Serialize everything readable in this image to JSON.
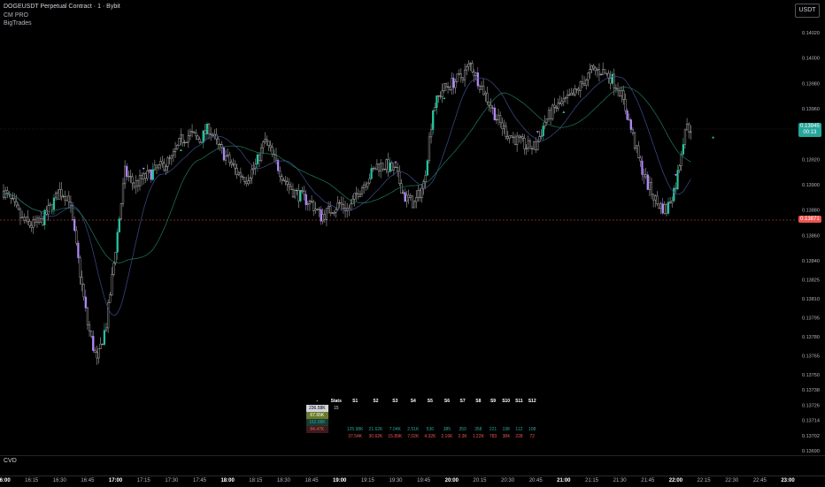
{
  "header": {
    "symbol_title": "DOGEUSDT Perpetual Contract · 1 · Bybit",
    "indicator_1": "CM PRO",
    "indicator_2": "BigTrades",
    "currency": "USDT"
  },
  "price_axis": {
    "labels": [
      "0.14020",
      "0.14000",
      "0.13980",
      "0.13960",
      "0.13945",
      "0.13920",
      "0.13900",
      "0.13880",
      "0.13871",
      "0.13860",
      "0.13840",
      "0.13825",
      "0.13810",
      "0.13795",
      "0.13780",
      "0.13765",
      "0.13750",
      "0.13738",
      "0.13726",
      "0.13714",
      "0.13702",
      "0.13690"
    ],
    "current_price": "0.13945",
    "countdown": "00:13",
    "marked_price": "0.13871"
  },
  "time_axis": {
    "labels": [
      "16:00",
      "16:15",
      "16:30",
      "16:45",
      "17:00",
      "17:15",
      "17:30",
      "17:45",
      "18:00",
      "18:15",
      "18:30",
      "18:45",
      "19:00",
      "19:15",
      "19:30",
      "19:45",
      "20:00",
      "20:15",
      "20:30",
      "20:45",
      "21:00",
      "21:15",
      "21:30",
      "21:45",
      "22:00",
      "22:15",
      "22:30",
      "22:45",
      "23:00"
    ],
    "bold": [
      "16:00",
      "17:00",
      "18:00",
      "19:00",
      "20:00",
      "21:00",
      "22:00",
      "23:00"
    ]
  },
  "bottom_pane": {
    "label": "CVD"
  },
  "stats_table": {
    "header": [
      "-",
      "Stats",
      "S1",
      "S2",
      "S3",
      "S4",
      "S5",
      "S6",
      "S7",
      "S8",
      "S9",
      "S10",
      "S11",
      "S12"
    ],
    "rows": [
      [
        "236.58K",
        "15",
        "",
        "",
        "",
        "",
        "",
        "",
        "",
        "",
        "",
        "",
        "",
        ""
      ],
      [
        "67.65K",
        "",
        "",
        "",
        "",
        "",
        "",
        "",
        "",
        "",
        "",
        "",
        "",
        ""
      ],
      [
        "152.08K",
        "",
        "",
        "",
        "",
        "",
        "",
        "",
        "",
        "",
        "",
        "",
        "",
        ""
      ],
      [
        "84.47K",
        "",
        "125.98K",
        "21.62K",
        "7.04K",
        "2.51K",
        "536",
        "385",
        "359",
        "358",
        "221",
        "198",
        "112",
        "108"
      ],
      [
        "",
        "",
        "37.54K",
        "30.62K",
        "15.89K",
        "7.02K",
        "4.32K",
        "2.16K",
        "2.3K",
        "1.22K",
        "783",
        "384",
        "228",
        "72"
      ]
    ]
  },
  "colors": {
    "background": "#000000",
    "candle_neutral": "#c8c8c8",
    "candle_bull_highlight": "#26c6a2",
    "candle_bear_highlight": "#b388ff",
    "ma_line_1": "#3f4d8f",
    "ma_line_2": "#1f7a5c",
    "current_price_tag": "#26a69a",
    "marked_price_tag": "#ef5350"
  },
  "chart_data": {
    "type": "candlestick",
    "x_range": [
      "16:00",
      "23:00"
    ],
    "y_range": [
      0.1369,
      0.1402
    ],
    "close_path": [
      [
        "16:00",
        0.13895
      ],
      [
        "16:05",
        0.13885
      ],
      [
        "16:10",
        0.13872
      ],
      [
        "16:15",
        0.13868
      ],
      [
        "16:20",
        0.1387
      ],
      [
        "16:25",
        0.13882
      ],
      [
        "16:30",
        0.13895
      ],
      [
        "16:35",
        0.1389
      ],
      [
        "16:40",
        0.1384
      ],
      [
        "16:45",
        0.1379
      ],
      [
        "16:50",
        0.1376
      ],
      [
        "16:55",
        0.1379
      ],
      [
        "17:00",
        0.1385
      ],
      [
        "17:05",
        0.1391
      ],
      [
        "17:10",
        0.139
      ],
      [
        "17:15",
        0.13905
      ],
      [
        "17:20",
        0.1391
      ],
      [
        "17:25",
        0.13915
      ],
      [
        "17:30",
        0.1392
      ],
      [
        "17:35",
        0.13935
      ],
      [
        "17:40",
        0.1394
      ],
      [
        "17:45",
        0.13935
      ],
      [
        "17:50",
        0.13945
      ],
      [
        "17:55",
        0.1393
      ],
      [
        "18:00",
        0.1392
      ],
      [
        "18:05",
        0.1391
      ],
      [
        "18:10",
        0.13905
      ],
      [
        "18:15",
        0.13915
      ],
      [
        "18:20",
        0.13935
      ],
      [
        "18:25",
        0.1392
      ],
      [
        "18:30",
        0.13905
      ],
      [
        "18:35",
        0.13895
      ],
      [
        "18:40",
        0.1389
      ],
      [
        "18:45",
        0.13885
      ],
      [
        "18:50",
        0.13875
      ],
      [
        "18:55",
        0.1388
      ],
      [
        "19:00",
        0.13885
      ],
      [
        "19:05",
        0.1388
      ],
      [
        "19:10",
        0.13895
      ],
      [
        "19:15",
        0.13905
      ],
      [
        "19:20",
        0.13915
      ],
      [
        "19:25",
        0.13915
      ],
      [
        "19:30",
        0.1391
      ],
      [
        "19:35",
        0.1389
      ],
      [
        "19:40",
        0.13885
      ],
      [
        "19:45",
        0.139
      ],
      [
        "19:50",
        0.1396
      ],
      [
        "19:55",
        0.13975
      ],
      [
        "20:00",
        0.1398
      ],
      [
        "20:05",
        0.13985
      ],
      [
        "20:10",
        0.13995
      ],
      [
        "20:15",
        0.1398
      ],
      [
        "20:20",
        0.13965
      ],
      [
        "20:25",
        0.1395
      ],
      [
        "20:30",
        0.1394
      ],
      [
        "20:35",
        0.13935
      ],
      [
        "20:40",
        0.1393
      ],
      [
        "20:45",
        0.1393
      ],
      [
        "20:50",
        0.1395
      ],
      [
        "20:55",
        0.1396
      ],
      [
        "21:00",
        0.13965
      ],
      [
        "21:05",
        0.1397
      ],
      [
        "21:10",
        0.1398
      ],
      [
        "21:15",
        0.1399
      ],
      [
        "21:20",
        0.1399
      ],
      [
        "21:25",
        0.13985
      ],
      [
        "21:30",
        0.13975
      ],
      [
        "21:35",
        0.1395
      ],
      [
        "21:40",
        0.1392
      ],
      [
        "21:45",
        0.139
      ],
      [
        "21:50",
        0.13885
      ],
      [
        "21:55",
        0.1388
      ],
      [
        "22:00",
        0.139
      ],
      [
        "22:05",
        0.13945
      ],
      [
        "22:08",
        0.13945
      ]
    ]
  }
}
